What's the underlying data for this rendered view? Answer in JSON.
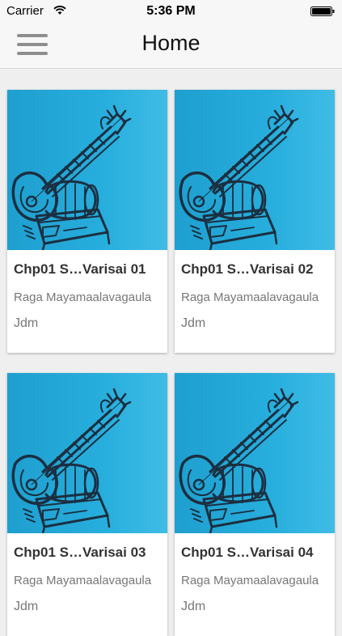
{
  "status_bar": {
    "carrier": "Carrier",
    "time": "5:36 PM"
  },
  "nav": {
    "title": "Home",
    "menu_icon": "hamburger-menu-icon"
  },
  "colors": {
    "art_blue": "#23a9d8",
    "art_blue_light": "#5cc6ec",
    "ink": "#1b2f40"
  },
  "cards": [
    {
      "title": "Chp01 S…Varisai 01",
      "subtitle": "Raga Mayamaalavagaula",
      "author": "Jdm",
      "icon": "veena-instrument-art"
    },
    {
      "title": "Chp01 S…Varisai 02",
      "subtitle": "Raga Mayamaalavagaula",
      "author": "Jdm",
      "icon": "veena-instrument-art"
    },
    {
      "title": "Chp01 S…Varisai 03",
      "subtitle": "Raga Mayamaalavagaula",
      "author": "Jdm",
      "icon": "veena-instrument-art"
    },
    {
      "title": "Chp01 S…Varisai 04",
      "subtitle": "Raga Mayamaalavagaula",
      "author": "Jdm",
      "icon": "veena-instrument-art"
    }
  ]
}
